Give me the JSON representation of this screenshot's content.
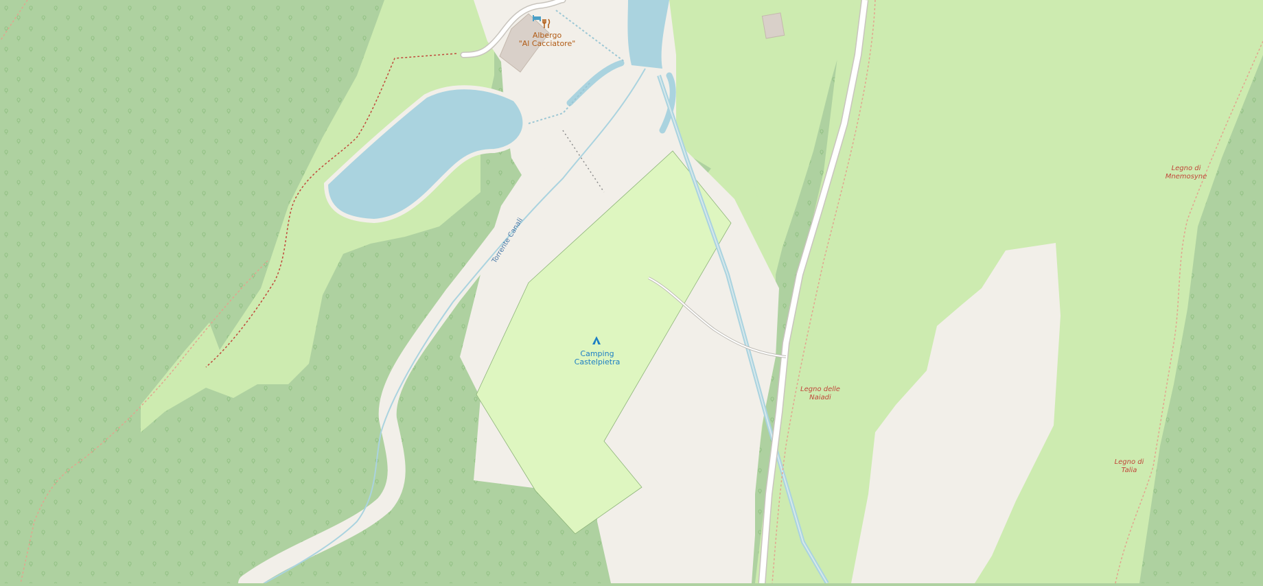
{
  "map": {
    "colors": {
      "forest": "#aed1a0",
      "meadow": "#cdebb0",
      "campsite": "#def6c0",
      "bare": "#f2efe9",
      "water": "#aad3df",
      "track": "#ffffff",
      "path": "#c0473a"
    },
    "pois": [
      {
        "id": "albergo",
        "icons": [
          "bed-icon",
          "restaurant-icon"
        ],
        "lines": [
          "Albergo",
          "\"Al Cacciatore\""
        ]
      },
      {
        "id": "camping",
        "icons": [
          "tent-icon"
        ],
        "lines": [
          "Camping",
          "Castelpietra"
        ]
      }
    ],
    "woods": [
      {
        "lines": [
          "Legno di",
          "Mnemosyne"
        ]
      },
      {
        "lines": [
          "Legno delle",
          "Naiadi"
        ]
      },
      {
        "lines": [
          "Legno di",
          "Talia"
        ]
      }
    ],
    "stream": {
      "name": "Torrente Canali"
    }
  }
}
